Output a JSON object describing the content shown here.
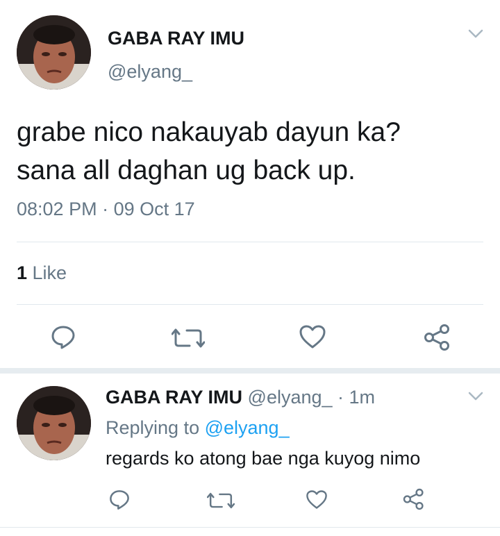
{
  "tweet": {
    "author_name": "GABA RAY IMU",
    "author_handle": "@elyang_",
    "text_line1": "grabe nico nakauyab dayun ka?",
    "text_line2": "sana all daghan ug back up.",
    "time": "08:02 PM",
    "date_sep": " · ",
    "date": "09 Oct 17",
    "likes_count": "1",
    "likes_label": " Like"
  },
  "reply": {
    "author_name": "GABA RAY IMU",
    "author_handle": "@elyang_",
    "age": " · 1m",
    "replying_prefix": "Replying to ",
    "replying_handle": "@elyang_",
    "text": "regards ko atong bae nga kuyog nimo"
  },
  "icons": {
    "reply": "reply-icon",
    "retweet": "retweet-icon",
    "like": "heart-icon",
    "share": "share-icon",
    "menu": "chevron-down-icon"
  },
  "colors": {
    "text": "#14171a",
    "secondary": "#657786",
    "link": "#1da1f2",
    "divider": "#e1e8ed"
  }
}
